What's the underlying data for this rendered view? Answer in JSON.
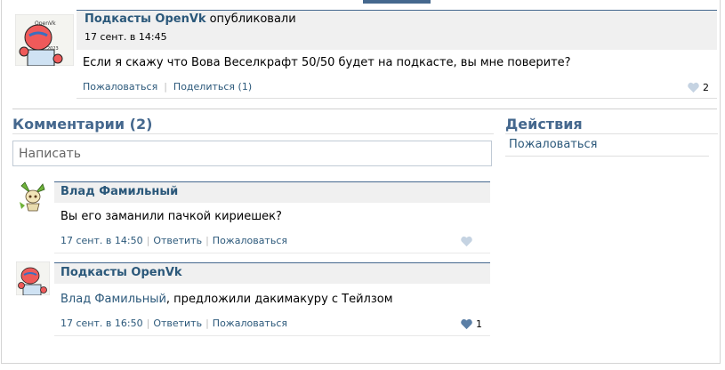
{
  "post": {
    "author": "Подкасты OpenVk",
    "action": "опубликовали",
    "time": "17 сент. в 14:45",
    "text": "Если я скажу что Вова Веселкрафт 50/50 будет на подкасте, вы мне поверите?",
    "report_label": "Пожаловаться",
    "share_label": "Поделиться",
    "share_count": "(1)",
    "likes": "2",
    "avatar_icon": "openvk-podcast-avatar"
  },
  "comments": {
    "title": "Комментарии (2)",
    "input_placeholder": "Написать",
    "items": [
      {
        "author": "Влад Фамильный",
        "text": "Вы его заманили пачкой кириешек?",
        "time": "17 сент. в 14:50",
        "reply_label": "Ответить",
        "report_label": "Пожаловаться",
        "likes": "",
        "avatar_icon": "leafeon-avatar"
      },
      {
        "author": "Подкасты OpenVk",
        "mention": "Влад Фамильный",
        "text": ", предложили дакимакуру с Тейлзом",
        "time": "17 сент. в 16:50",
        "reply_label": "Ответить",
        "report_label": "Пожаловаться",
        "likes": "1",
        "avatar_icon": "openvk-podcast-avatar"
      }
    ]
  },
  "actions": {
    "title": "Действия",
    "items": [
      "Пожаловаться"
    ]
  },
  "colors": {
    "accent": "#45688e",
    "link": "#2b587a",
    "header_bg": "#f0f0f0",
    "heart_active": "#5b7fa6",
    "heart_inactive": "#c5d3e2"
  }
}
